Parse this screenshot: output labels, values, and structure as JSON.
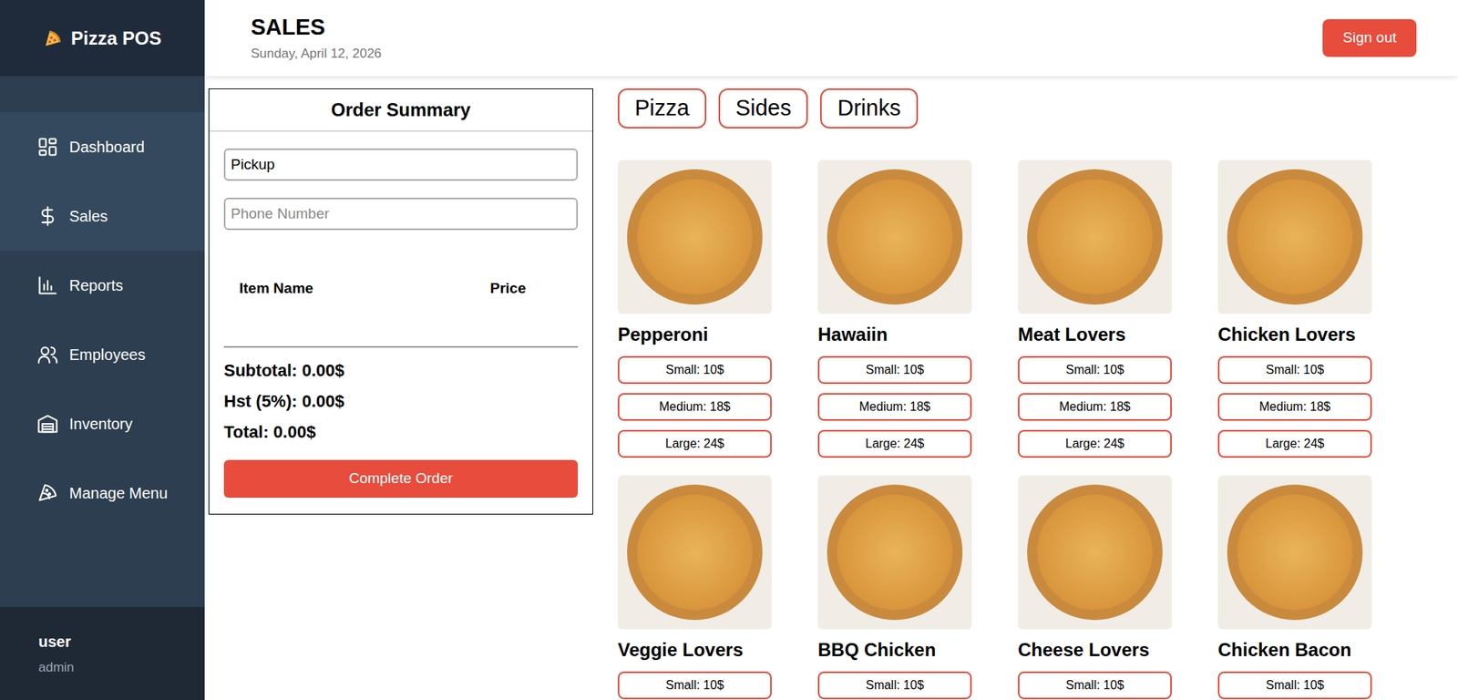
{
  "app": {
    "title": "Pizza POS"
  },
  "sidebar": {
    "items": [
      {
        "label": "Dashboard",
        "selected": false,
        "hovered": true
      },
      {
        "label": "Sales",
        "selected": true,
        "hovered": false
      },
      {
        "label": "Reports",
        "selected": false,
        "hovered": false
      },
      {
        "label": "Employees",
        "selected": false,
        "hovered": false
      },
      {
        "label": "Inventory",
        "selected": false,
        "hovered": false
      },
      {
        "label": "Manage Menu",
        "selected": false,
        "hovered": false
      }
    ],
    "user": {
      "name": "user",
      "role": "admin"
    }
  },
  "header": {
    "title": "SALES",
    "date": "Sunday, April 12, 2026",
    "sign_out": "Sign out"
  },
  "order": {
    "title": "Order Summary",
    "order_type": "Pickup",
    "phone_placeholder": "Phone Number",
    "columns": [
      "Item Name",
      "Price"
    ],
    "subtotal": "Subtotal: 0.00$",
    "hst": "Hst (5%): 0.00$",
    "total": "Total: 0.00$",
    "button": "Complete Order"
  },
  "categories": [
    {
      "label": "Pizza",
      "selected": false
    },
    {
      "label": "Sides",
      "selected": false
    },
    {
      "label": "Drinks",
      "selected": false
    }
  ],
  "menu": [
    {
      "name": "Pepperoni",
      "sizes": [
        "Small: 10$",
        "Medium: 18$",
        "Large: 24$"
      ]
    },
    {
      "name": "Hawaiin",
      "sizes": [
        "Small: 10$",
        "Medium: 18$",
        "Large: 24$"
      ]
    },
    {
      "name": "Meat Lovers",
      "sizes": [
        "Small: 10$",
        "Medium: 18$",
        "Large: 24$"
      ]
    },
    {
      "name": "Chicken Lovers",
      "sizes": [
        "Small: 10$",
        "Medium: 18$",
        "Large: 24$"
      ]
    },
    {
      "name": "Veggie Lovers",
      "sizes": [
        "Small: 10$"
      ]
    },
    {
      "name": "BBQ Chicken",
      "sizes": [
        "Small: 10$"
      ]
    },
    {
      "name": "Cheese Lovers",
      "sizes": [
        "Small: 10$"
      ]
    },
    {
      "name": "Chicken Bacon",
      "sizes": [
        "Small: 10$"
      ]
    }
  ]
}
